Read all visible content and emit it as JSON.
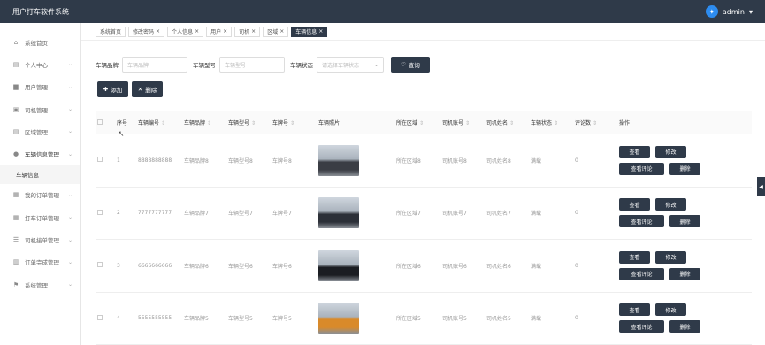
{
  "app": {
    "title": "用户打车软件系统",
    "user": "admin",
    "avatar_letter": "✦"
  },
  "sidebar": {
    "items": [
      {
        "label": "系统首页",
        "icon": "home-icon",
        "glyph": "⌂",
        "chev": false
      },
      {
        "label": "个人中心",
        "icon": "calendar-icon",
        "glyph": "▤",
        "chev": true
      },
      {
        "label": "用户管理",
        "icon": "user-icon",
        "glyph": "▆",
        "chev": true
      },
      {
        "label": "司机管理",
        "icon": "briefcase-icon",
        "glyph": "▣",
        "chev": true
      },
      {
        "label": "区域管理",
        "icon": "calendar-icon",
        "glyph": "▤",
        "chev": true
      },
      {
        "label": "车辆信息管理",
        "icon": "location-icon",
        "glyph": "●",
        "chev": true
      }
    ],
    "sub": "车辆信息",
    "items2": [
      {
        "label": "我的订单管理",
        "icon": "grid-icon",
        "glyph": "▦",
        "chev": true
      },
      {
        "label": "打车订单管理",
        "icon": "grid-icon",
        "glyph": "▦",
        "chev": true
      },
      {
        "label": "司机接单管理",
        "icon": "list-icon",
        "glyph": "☰",
        "chev": true
      },
      {
        "label": "订单完成管理",
        "icon": "clipboard-icon",
        "glyph": "▥",
        "chev": true
      },
      {
        "label": "系统管理",
        "icon": "flag-icon",
        "glyph": "⚑",
        "chev": true
      }
    ]
  },
  "tabs": [
    {
      "label": "系统首页",
      "close": ""
    },
    {
      "label": "修改密码",
      "close": "×"
    },
    {
      "label": "个人信息",
      "close": "×"
    },
    {
      "label": "用户",
      "close": "×"
    },
    {
      "label": "司机",
      "close": "×"
    },
    {
      "label": "区域",
      "close": "×"
    },
    {
      "label": "车辆信息",
      "close": "×"
    }
  ],
  "search": {
    "brand_label": "车辆品牌",
    "brand_ph": "车辆品牌",
    "model_label": "车辆型号",
    "model_ph": "车辆型号",
    "status_label": "车辆状态",
    "status_ph": "请选择车辆状态",
    "query": "查询"
  },
  "actions": {
    "add": "添加",
    "delete": "删除"
  },
  "columns": [
    "序号",
    "车辆编号",
    "车辆品牌",
    "车辆型号",
    "车牌号",
    "车辆照片",
    "所在区域",
    "司机账号",
    "司机姓名",
    "车辆状态",
    "评论数",
    "操作"
  ],
  "rows": [
    {
      "idx": "1",
      "no": "8888888888",
      "brand": "车辆品牌8",
      "model": "车辆型号8",
      "plate": "车牌号8",
      "area": "所在区域8",
      "acct": "司机账号8",
      "name": "司机姓名8",
      "status": "满载",
      "comments": "0",
      "car_color": "#3a3d44"
    },
    {
      "idx": "2",
      "no": "7777777777",
      "brand": "车辆品牌7",
      "model": "车辆型号7",
      "plate": "车牌号7",
      "area": "所在区域7",
      "acct": "司机账号7",
      "name": "司机姓名7",
      "status": "满载",
      "comments": "0",
      "car_color": "#2c3038"
    },
    {
      "idx": "3",
      "no": "6666666666",
      "brand": "车辆品牌6",
      "model": "车辆型号6",
      "plate": "车牌号6",
      "area": "所在区域6",
      "acct": "司机账号6",
      "name": "司机姓名6",
      "status": "满载",
      "comments": "0",
      "car_color": "#1b1d22"
    },
    {
      "idx": "4",
      "no": "5555555555",
      "brand": "车辆品牌5",
      "model": "车辆型号5",
      "plate": "车牌号5",
      "area": "所在区域5",
      "acct": "司机账号5",
      "name": "司机姓名5",
      "status": "满载",
      "comments": "0",
      "car_color": "#d98a2a"
    }
  ],
  "ops": {
    "view": "查看",
    "edit": "修改",
    "review": "查看评论",
    "del": "删除"
  }
}
